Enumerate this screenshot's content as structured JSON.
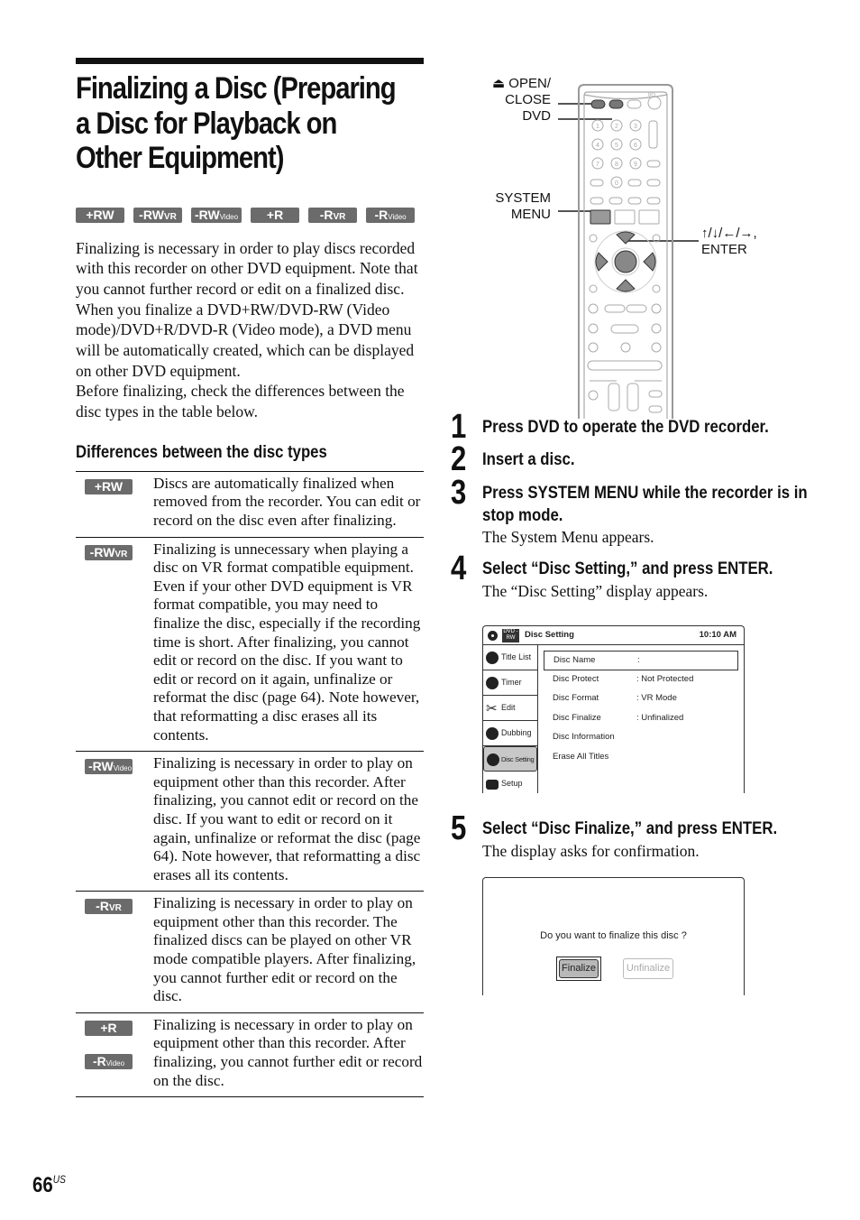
{
  "page": {
    "title": "Finalizing a Disc (Preparing a Disc for Playback on Other Equipment)",
    "title_lines": [
      "Finalizing a Disc (Preparing",
      "a Disc for Playback on",
      "Other Equipment)"
    ],
    "page_number": "66",
    "page_region": "US"
  },
  "disc_badges": [
    {
      "main": "+RW",
      "sub": ""
    },
    {
      "main": "-RW",
      "sub": "VR"
    },
    {
      "main": "-RW",
      "sub": "Video"
    },
    {
      "main": "+R",
      "sub": ""
    },
    {
      "main": "-R",
      "sub": "VR"
    },
    {
      "main": "-R",
      "sub": "Video"
    }
  ],
  "intro_paragraphs": [
    "Finalizing is necessary in order to play discs recorded with this recorder on other DVD equipment. Note that you cannot further record or edit on a finalized disc.",
    "When you finalize a DVD+RW/DVD-RW (Video mode)/DVD+R/DVD-R (Video mode), a DVD menu will be automatically created, which can be displayed on other DVD equipment.",
    "Before finalizing, check the differences between the disc types in the table below."
  ],
  "differences": {
    "heading": "Differences between the disc types",
    "rows": [
      {
        "badges": [
          {
            "main": "+RW",
            "sub": ""
          }
        ],
        "text": "Discs are automatically finalized when removed from the recorder. You can edit or record on the disc even after finalizing."
      },
      {
        "badges": [
          {
            "main": "-RW",
            "sub": "VR"
          }
        ],
        "text": "Finalizing is unnecessary when playing a disc on VR format compatible equipment. Even if your other DVD equipment is VR format compatible, you may need to finalize the disc, especially if the recording time is short. After finalizing, you cannot edit or record on the disc. If you want to edit or record on it again, unfinalize or reformat the disc (page 64). Note however, that reformatting a disc erases all its contents."
      },
      {
        "badges": [
          {
            "main": "-RW",
            "sub": "Video"
          }
        ],
        "text": "Finalizing is necessary in order to play on equipment other than this recorder. After finalizing, you cannot edit or record on the disc. If you want to edit or record on it again, unfinalize or reformat the disc (page 64). Note however, that reformatting a disc erases all its contents."
      },
      {
        "badges": [
          {
            "main": "-R",
            "sub": "VR"
          }
        ],
        "text": "Finalizing is necessary in order to play on equipment other than this recorder. The finalized discs can be played on other VR mode compatible players. After finalizing, you cannot further edit or record on the disc."
      },
      {
        "badges": [
          {
            "main": "+R",
            "sub": ""
          },
          {
            "main": "-R",
            "sub": "Video"
          }
        ],
        "text": "Finalizing is necessary in order to play on equipment other than this recorder. After finalizing, you cannot further edit or record on the disc."
      }
    ]
  },
  "remote": {
    "labels": {
      "open_close_line1": "⏏ OPEN/",
      "open_close_line2": "CLOSE",
      "dvd": "DVD",
      "system_menu_line1": "SYSTEM",
      "system_menu_line2": "MENU",
      "arrows_line1": "↑/↓/←/→,",
      "arrows_line2": "ENTER"
    },
    "number_keys": [
      "1",
      "2",
      "3",
      "4",
      "5",
      "6",
      "7",
      "8",
      "9",
      "0"
    ],
    "power_label": "I/⏻"
  },
  "steps": [
    {
      "num": "1",
      "title": "Press DVD to operate the DVD recorder.",
      "sub": ""
    },
    {
      "num": "2",
      "title": "Insert a disc.",
      "sub": ""
    },
    {
      "num": "3",
      "title": "Press SYSTEM MENU while the recorder is in stop mode.",
      "sub": "The System Menu appears."
    },
    {
      "num": "4",
      "title": "Select “Disc Setting,” and press ENTER.",
      "sub": "The “Disc Setting” display appears."
    },
    {
      "num": "5",
      "title": "Select “Disc Finalize,” and press ENTER.",
      "sub": "The display asks for confirmation."
    }
  ],
  "disc_setting_screen": {
    "disc_tag": "DVD -RW",
    "title": "Disc Setting",
    "time": "10:10 AM",
    "sidebar": [
      {
        "label": "Title List",
        "icon": "title-list-icon",
        "active": false
      },
      {
        "label": "Timer",
        "icon": "timer-icon",
        "active": false
      },
      {
        "label": "Edit",
        "icon": "edit-scissors-icon",
        "active": false
      },
      {
        "label": "Dubbing",
        "icon": "dubbing-icon",
        "active": false
      },
      {
        "label": "Disc Setting",
        "icon": "disc-setting-icon",
        "active": true
      },
      {
        "label": "Setup",
        "icon": "setup-toolbox-icon",
        "active": false
      }
    ],
    "rows": [
      {
        "key": "Disc Name",
        "value": ":",
        "selected": true
      },
      {
        "key": "Disc Protect",
        "value": ":  Not Protected",
        "selected": false
      },
      {
        "key": "Disc Format",
        "value": ":  VR Mode",
        "selected": false
      },
      {
        "key": "Disc Finalize",
        "value": ":  Unfinalized",
        "selected": false
      },
      {
        "key": "Disc Information",
        "value": "",
        "selected": false
      },
      {
        "key": "Erase All Titles",
        "value": "",
        "selected": false
      }
    ]
  },
  "confirm_screen": {
    "message": "Do you want to finalize this disc ?",
    "finalize_label": "Finalize",
    "unfinalize_label": "Unfinalize"
  }
}
